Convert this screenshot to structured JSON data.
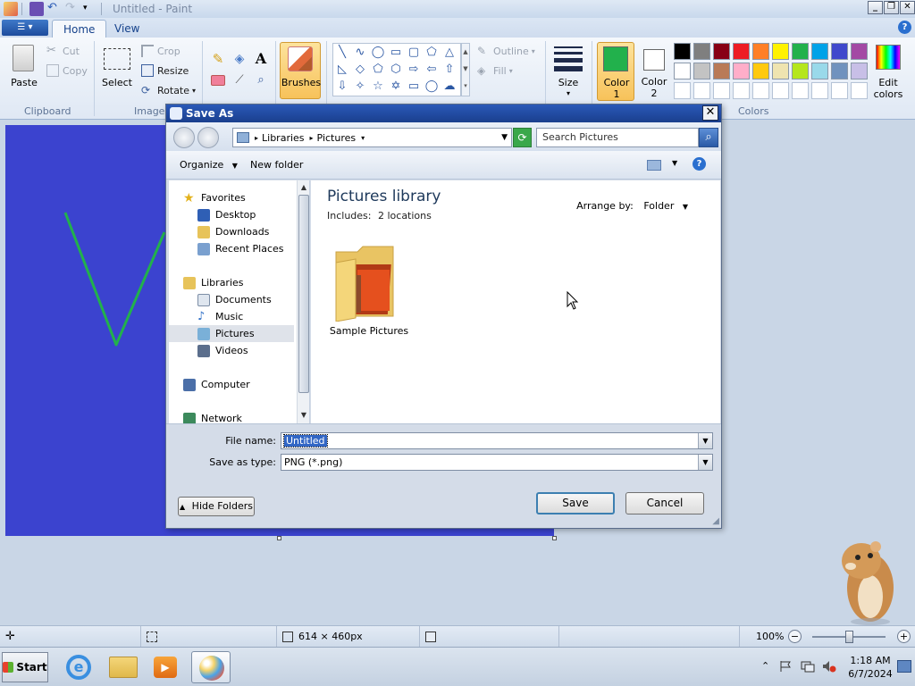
{
  "titlebar": {
    "title": "Untitled - Paint",
    "minimize": "_",
    "restore": "❐",
    "close": "✕"
  },
  "tabs": {
    "app_menu": "☰ ▾",
    "home": "Home",
    "view": "View",
    "help": "?"
  },
  "ribbon": {
    "clipboard": {
      "paste": "Paste",
      "cut": "Cut",
      "copy": "Copy",
      "group": "Clipboard"
    },
    "image": {
      "select": "Select",
      "crop": "Crop",
      "resize": "Resize",
      "rotate": "Rotate",
      "group": "Image"
    },
    "tools": {
      "text_icon": "A"
    },
    "brushes": "Brushes",
    "shapes": {
      "outline": "Outline",
      "fill": "Fill"
    },
    "size": "Size",
    "color1": {
      "label": "Color",
      "num": "1",
      "value": "#22b14c"
    },
    "color2": {
      "label": "Color",
      "num": "2",
      "value": "#ffffff"
    },
    "colors_group": "Colors",
    "edit_colors": {
      "line1": "Edit",
      "line2": "colors"
    },
    "palette_row1": [
      "#000000",
      "#7f7f7f",
      "#880015",
      "#ed1c24",
      "#ff7f27",
      "#fff200",
      "#22b14c",
      "#00a2e8",
      "#3f48cc",
      "#a349a4"
    ],
    "palette_row2": [
      "#ffffff",
      "#c3c3c3",
      "#b97a57",
      "#ffaec9",
      "#ffc90e",
      "#efe4b0",
      "#b5e61d",
      "#99d9ea",
      "#7092be",
      "#c8bfe7"
    ]
  },
  "dialog": {
    "title": "Save As",
    "address": {
      "part1": "Libraries",
      "part2": "Pictures"
    },
    "search_placeholder": "Search Pictures",
    "toolbar": {
      "organize": "Organize",
      "new_folder": "New folder"
    },
    "nav": {
      "favorites": "Favorites",
      "desktop": "Desktop",
      "downloads": "Downloads",
      "recent": "Recent Places",
      "libraries": "Libraries",
      "documents": "Documents",
      "music": "Music",
      "pictures": "Pictures",
      "videos": "Videos",
      "computer": "Computer",
      "network": "Network"
    },
    "content": {
      "title": "Pictures library",
      "includes_label": "Includes:",
      "includes_value": "2 locations",
      "arrange_label": "Arrange by:",
      "arrange_value": "Folder",
      "folder_name": "Sample Pictures"
    },
    "file_name_label": "File name:",
    "file_name_value": "Untitled",
    "save_type_label": "Save as type:",
    "save_type_value": "PNG (*.png)",
    "hide_folders": "Hide Folders",
    "save": "Save",
    "cancel": "Cancel"
  },
  "statusbar": {
    "canvas_size": "614 × 460px",
    "zoom": "100%"
  },
  "taskbar": {
    "start": "Start",
    "time": "1:18 AM",
    "date": "6/7/2024"
  }
}
